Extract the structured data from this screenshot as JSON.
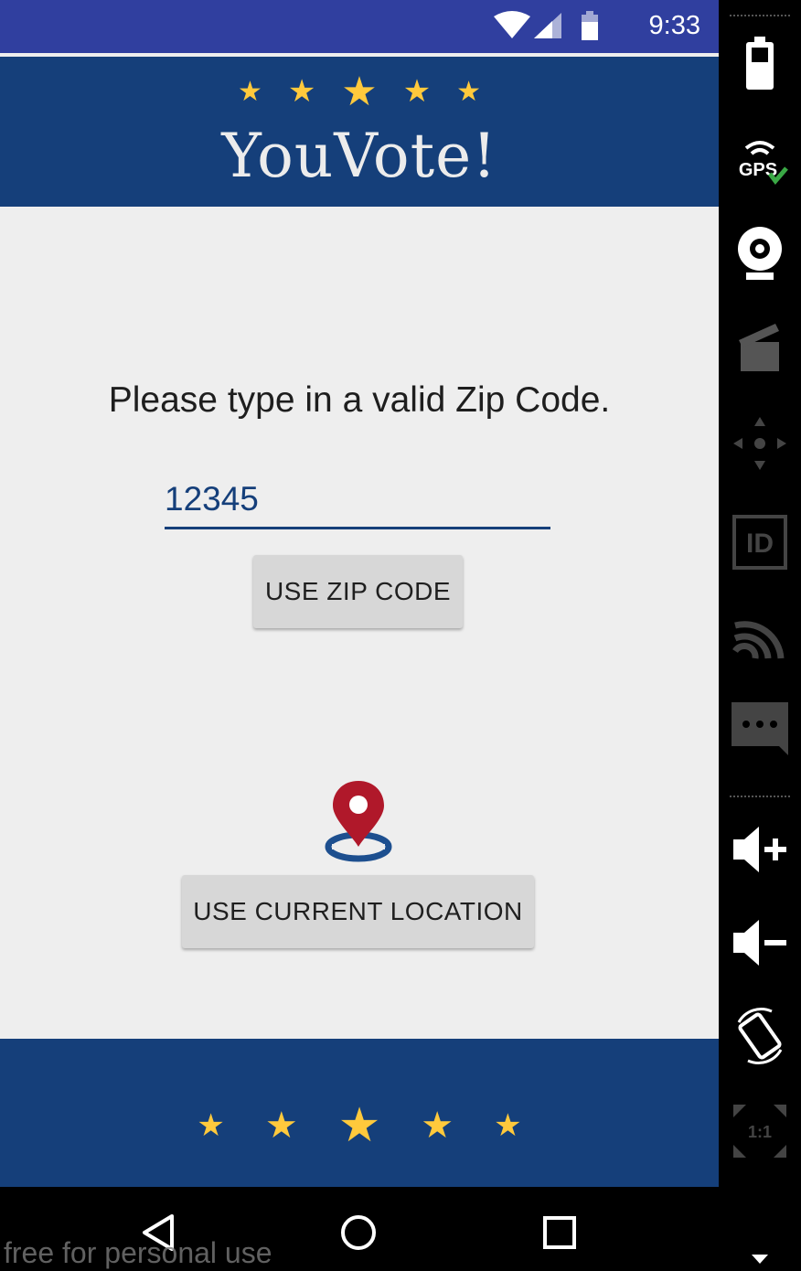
{
  "status_bar": {
    "time": "9:33",
    "icons": [
      "wifi-icon",
      "signal-icon",
      "battery-icon"
    ]
  },
  "header": {
    "title": "YouVote!",
    "stars": [
      "★",
      "★",
      "★",
      "★",
      "★"
    ]
  },
  "main": {
    "prompt": "Please type in a valid Zip Code.",
    "zip_value": "12345",
    "use_zip_label": "USE ZIP CODE",
    "use_location_label": "USE CURRENT LOCATION",
    "location_icon": "location-pin-icon"
  },
  "footer": {
    "stars": [
      "★",
      "★",
      "★",
      "★",
      "★"
    ]
  },
  "nav": {
    "buttons": [
      "back-icon",
      "home-icon",
      "recents-icon"
    ]
  },
  "watermark": "free for personal use",
  "emulator_panel": {
    "tools": [
      "battery-icon",
      "gps-icon",
      "camera-icon",
      "clapper-icon",
      "dpad-icon",
      "id-icon",
      "cast-icon",
      "message-icon",
      "volume-up-icon",
      "volume-down-icon",
      "rotate-icon",
      "one-to-one-icon"
    ],
    "gps_label": "GPS",
    "id_label": "ID",
    "scale_label": "1:1"
  },
  "colors": {
    "primary": "#153f7a",
    "status": "#303f9f",
    "star": "#ffc93c",
    "pin": "#b0182a",
    "background": "#eeeeee"
  }
}
